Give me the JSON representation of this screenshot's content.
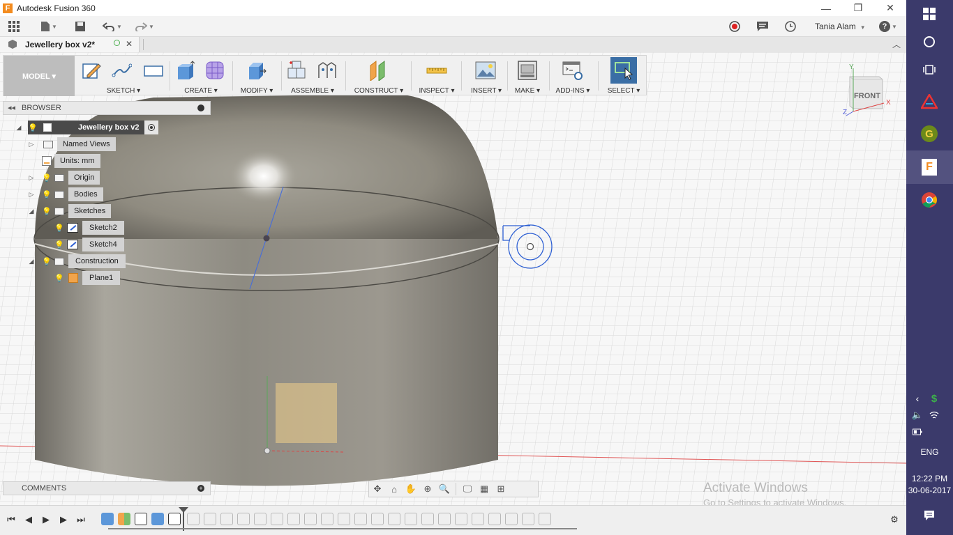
{
  "window": {
    "title": "Autodesk Fusion 360",
    "app_icon_letter": "F",
    "min_glyph": "—",
    "restore_glyph": "❐",
    "close_glyph": "✕"
  },
  "app_toolbar": {
    "user_name": "Tania Alam",
    "help_glyph": "?"
  },
  "document_tab": {
    "title": "Jewellery box v2*",
    "close_glyph": "✕"
  },
  "ribbon": {
    "workspace": "MODEL ▾",
    "groups": [
      {
        "label": "SKETCH ▾"
      },
      {
        "label": "CREATE ▾"
      },
      {
        "label": "MODIFY ▾"
      },
      {
        "label": "ASSEMBLE ▾"
      },
      {
        "label": "CONSTRUCT ▾"
      },
      {
        "label": "INSPECT ▾"
      },
      {
        "label": "INSERT ▾"
      },
      {
        "label": "MAKE ▾"
      },
      {
        "label": "ADD-INS ▾"
      },
      {
        "label": "SELECT ▾"
      }
    ]
  },
  "browser": {
    "title": "BROWSER",
    "root": "Jewellery box v2",
    "items": [
      {
        "label": "Named Views"
      },
      {
        "label": "Units: mm"
      },
      {
        "label": "Origin"
      },
      {
        "label": "Bodies"
      },
      {
        "label": "Sketches"
      },
      {
        "label": "Sketch2"
      },
      {
        "label": "Sketch4"
      },
      {
        "label": "Construction"
      },
      {
        "label": "Plane1"
      }
    ]
  },
  "viewcube": {
    "face_label": "FRONT",
    "axis_y": "Y",
    "axis_x": "X",
    "axis_z": "Z"
  },
  "comments": {
    "title": "COMMENTS"
  },
  "watermark": {
    "line1": "Activate Windows",
    "line2": "Go to Settings to activate Windows."
  },
  "taskbar": {
    "time": "12:22 PM",
    "date": "30-06-2017",
    "language": "ENG"
  },
  "colors": {
    "windows_sidebar": "#3b3a6b",
    "select_accent": "#3a6ea5",
    "body_metal": "#8f8b80",
    "sketch_blue": "#2d5fd3",
    "fusion_orange": "#f38b1e"
  }
}
